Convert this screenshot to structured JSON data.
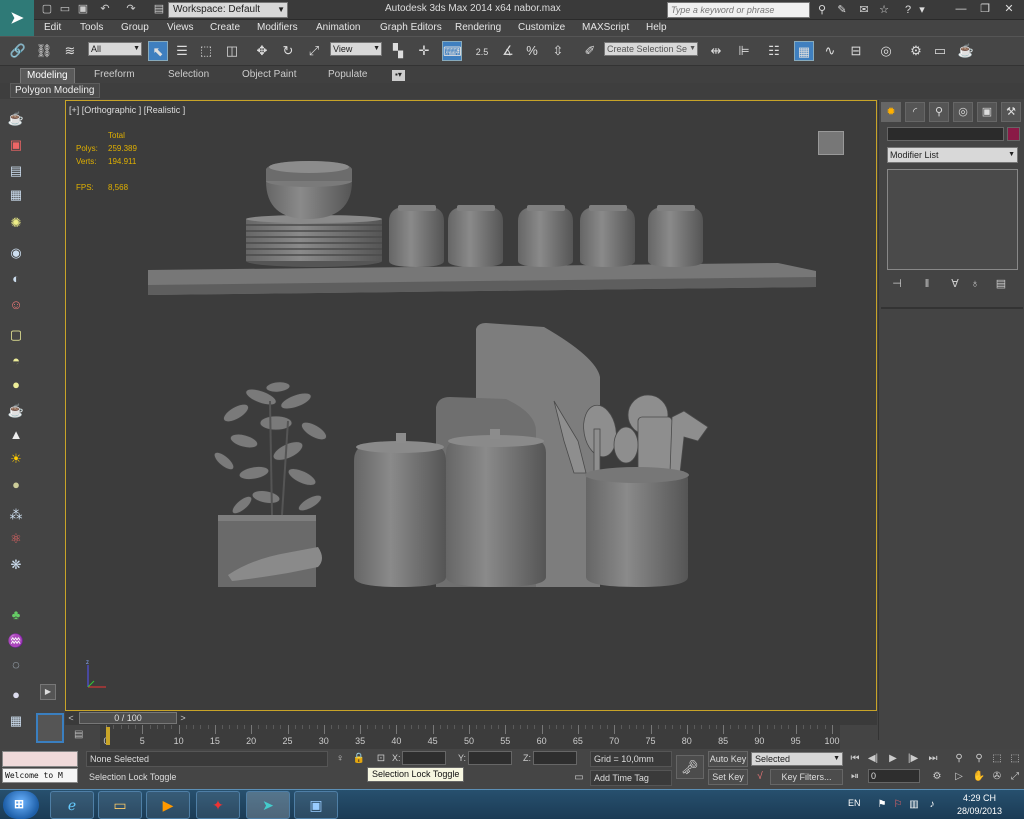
{
  "titlebar": {
    "workspace": "Workspace: Default",
    "app_title": "Autodesk 3ds Max  2014 x64",
    "file_name": "nabor.max",
    "search_placeholder": "Type a keyword or phrase"
  },
  "menu": [
    "Edit",
    "Tools",
    "Group",
    "Views",
    "Create",
    "Modifiers",
    "Animation",
    "Graph Editors",
    "Rendering",
    "Customize",
    "MAXScript",
    "Help"
  ],
  "toolbar": {
    "selection_filter": "All",
    "ref_coord": "View",
    "snap_value": "2.5",
    "named_selection": "Create Selection Se"
  },
  "ribbon": {
    "tabs": [
      "Modeling",
      "Freeform",
      "Selection",
      "Object Paint",
      "Populate"
    ],
    "sub_label": "Polygon Modeling"
  },
  "viewport": {
    "label": "[+] [Orthographic ] [Realistic ]",
    "stats_header": "Total",
    "polys_label": "Polys:",
    "polys_value": "259.389",
    "verts_label": "Verts:",
    "verts_value": "194.911",
    "fps_label": "FPS:",
    "fps_value": "8,568"
  },
  "command_panel": {
    "modifier_list": "Modifier List"
  },
  "timeline": {
    "frame_display": "0 / 100",
    "ticks": [
      0,
      5,
      10,
      15,
      20,
      25,
      30,
      35,
      40,
      45,
      50,
      55,
      60,
      65,
      70,
      75,
      80,
      85,
      90,
      95,
      100
    ]
  },
  "status": {
    "welcome": "Welcome to M",
    "selection_status": "None Selected",
    "prompt": "Selection Lock Toggle",
    "tooltip": "Selection Lock Toggle",
    "x_label": "X:",
    "y_label": "Y:",
    "z_label": "Z:",
    "grid": "Grid = 10,0mm",
    "add_time_tag": "Add Time Tag",
    "auto_key": "Auto Key",
    "set_key": "Set Key",
    "key_mode": "Selected",
    "key_filters": "Key Filters...",
    "current_frame": "0"
  },
  "taskbar": {
    "language": "EN",
    "time": "4:29 CH",
    "date": "28/09/2013"
  }
}
